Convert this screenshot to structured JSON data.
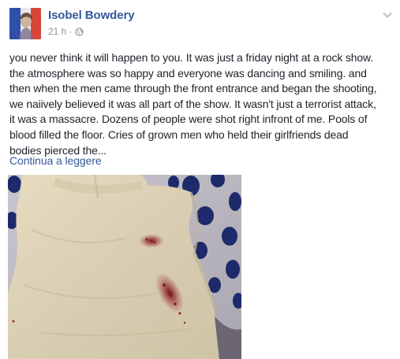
{
  "post": {
    "author": "Isobel Bowdery",
    "timestamp": "21 h",
    "separator": "·",
    "privacy_icon": "globe-icon",
    "menu_icon": "chevron-down-icon",
    "text_lines": [
      "you never think it will happen to you. It was just a friday night at a rock show.",
      "the atmosphere was so happy and everyone was dancing and smiling. and",
      "then when the men came through the front entrance and began the shooting,",
      "we naiively believed it was all part of the show. It wasn't just a terrorist attack,",
      "it was a massacre. Dozens of people were shot right infront of me. Pools of",
      "blood filled the floor. Cries of grown men who held their girlfriends dead",
      "bodies pierced the..."
    ],
    "read_more": "Continua a leggere"
  },
  "colors": {
    "link": "#365899",
    "text": "#1d2129",
    "meta": "#90949c",
    "flag_blue": "#0055a4",
    "flag_white": "#ffffff",
    "flag_red": "#ef4135"
  }
}
